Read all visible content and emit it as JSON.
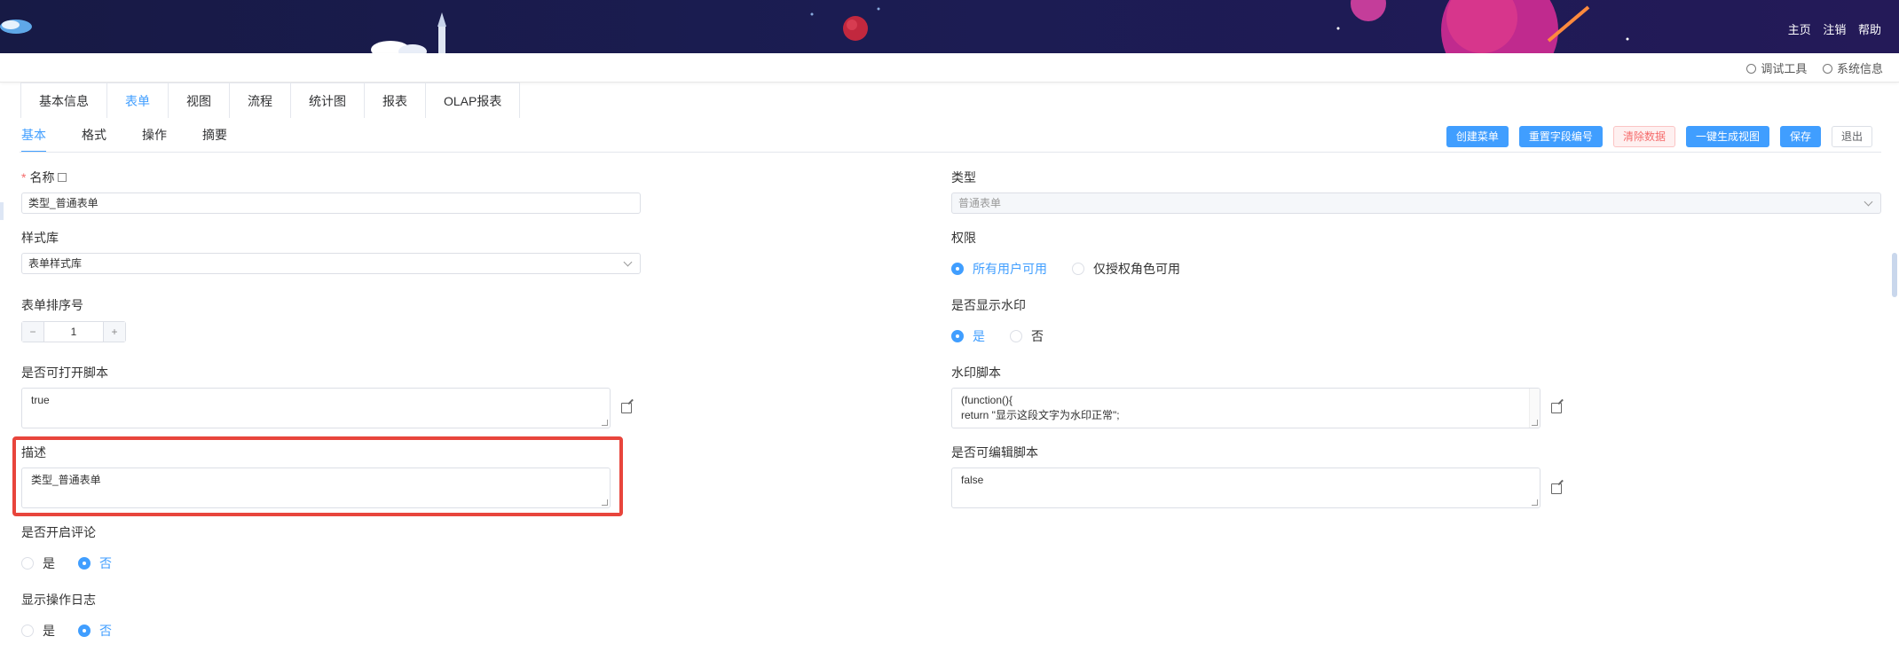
{
  "header": {
    "links": [
      "主页",
      "注销",
      "帮助"
    ],
    "colors": {
      "banner_bg": "#1b1c52"
    }
  },
  "toolbar": {
    "debug_tools": "调试工具",
    "system_info": "系统信息"
  },
  "main_tabs": {
    "items": [
      "基本信息",
      "表单",
      "视图",
      "流程",
      "统计图",
      "报表",
      "OLAP报表"
    ],
    "active": "表单"
  },
  "sub_tabs": {
    "items": [
      "基本",
      "格式",
      "操作",
      "摘要"
    ],
    "active": "基本"
  },
  "actions": {
    "create_menu": "创建菜单",
    "reset_field_no": "重置字段编号",
    "clear_data": "清除数据",
    "gen_view": "一键生成视图",
    "save": "保存",
    "exit": "退出"
  },
  "form": {
    "name_label": "名称",
    "name_value": "类型_普通表单",
    "type_label": "类型",
    "type_value": "普通表单",
    "style_lib_label": "样式库",
    "style_lib_value": "表单样式库",
    "permission_label": "权限",
    "permission_options": [
      "所有用户可用",
      "仅授权角色可用"
    ],
    "permission_selected": "所有用户可用",
    "sort_label": "表单排序号",
    "sort_value": "1",
    "sort_minus": "−",
    "sort_plus": "+",
    "watermark_label": "是否显示水印",
    "watermark_yes": "是",
    "watermark_no": "否",
    "watermark_selected": "是",
    "open_script_label": "是否可打开脚本",
    "open_script_value": "true",
    "watermark_script_label": "水印脚本",
    "watermark_script_value": "(function(){\nreturn \"显示这段文字为水印正常\";",
    "desc_label": "描述",
    "desc_value": "类型_普通表单",
    "edit_script_label": "是否可编辑脚本",
    "edit_script_value": "false",
    "comment_label": "是否开启评论",
    "comment_yes": "是",
    "comment_no": "否",
    "comment_selected": "否",
    "oplog_label": "显示操作日志",
    "oplog_yes": "是",
    "oplog_no": "否",
    "oplog_selected": "否"
  }
}
